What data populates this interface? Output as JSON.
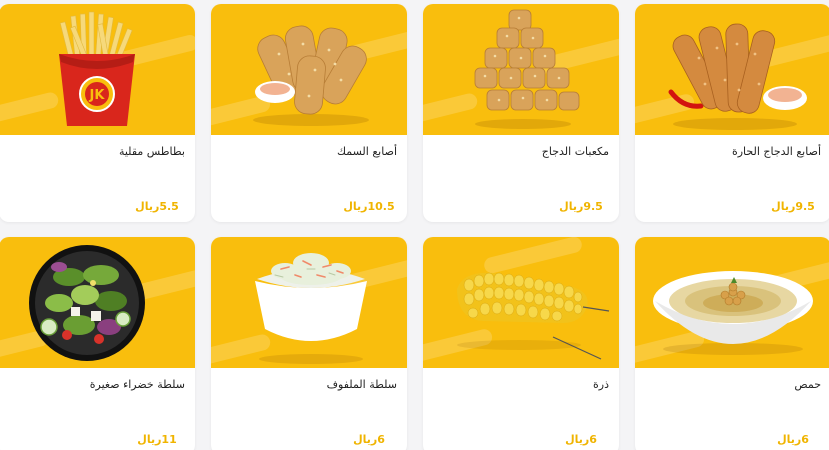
{
  "theme": {
    "accent": "#f9be0d",
    "price_color": "#f0b400"
  },
  "menu": {
    "items": [
      {
        "name": "بطاطس مقلية",
        "price": "5.5",
        "currency": "ريال",
        "image": "fries-icon"
      },
      {
        "name": "أصابع السمك",
        "price": "10.5",
        "currency": "ريال",
        "image": "fish-fingers-icon"
      },
      {
        "name": "مكعبات الدجاج",
        "price": "9.5",
        "currency": "ريال",
        "image": "chicken-cubes-icon"
      },
      {
        "name": "أصابع الدجاج الحارة",
        "price": "9.5",
        "currency": "ريال",
        "image": "spicy-chicken-fingers-icon"
      },
      {
        "name": "سلطة خضراء صغيرة",
        "price": "11",
        "currency": "ريال",
        "image": "green-salad-icon"
      },
      {
        "name": "سلطة الملفوف",
        "price": "6",
        "currency": "ريال",
        "image": "coleslaw-icon"
      },
      {
        "name": "ذرة",
        "price": "6",
        "currency": "ريال",
        "image": "corn-icon"
      },
      {
        "name": "حمص",
        "price": "6",
        "currency": "ريال",
        "image": "hummus-icon"
      }
    ]
  }
}
